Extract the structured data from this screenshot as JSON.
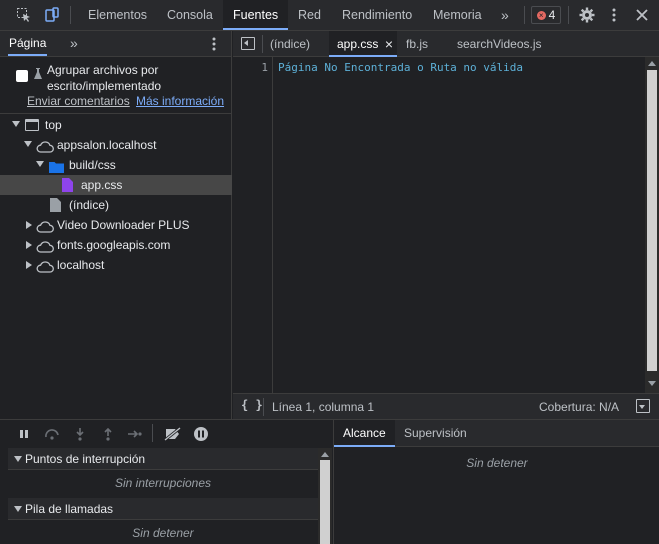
{
  "main_tabs": [
    "Elementos",
    "Consola",
    "Fuentes",
    "Red",
    "Rendimiento",
    "Memoria"
  ],
  "more_tabs": "»",
  "error_count": "4",
  "left": {
    "tab_label": "Página",
    "more": "»",
    "group_checkbox_label": "Agrupar archivos por escrito/implementado",
    "feedback_link": "Enviar comentarios",
    "more_info_link": "Más información",
    "tree": [
      {
        "label": "top",
        "icon": "frame-icon"
      },
      {
        "label": "appsalon.localhost",
        "icon": "cloud-icon"
      },
      {
        "label": "build/css",
        "icon": "folder-icon"
      },
      {
        "label": "app.css",
        "icon": "file-icon"
      },
      {
        "label": "(índice)",
        "icon": "file-icon"
      },
      {
        "label": "Video Downloader PLUS",
        "icon": "cloud-icon"
      },
      {
        "label": "fonts.googleapis.com",
        "icon": "cloud-icon"
      },
      {
        "label": "localhost",
        "icon": "cloud-icon"
      }
    ]
  },
  "editor": {
    "tabs": [
      "(índice)",
      "app.css",
      "fb.js",
      "searchVideos.js"
    ],
    "close_glyph": "×",
    "line_number": "1",
    "code_line": "Página No Encontrada o Ruta no válida",
    "status_left_icon": "{ }",
    "status_position": "Línea 1, columna 1",
    "status_coverage": "Cobertura: N/A"
  },
  "debugger": {
    "breakpoints_title": "Puntos de interrupción",
    "breakpoints_empty": "Sin interrupciones",
    "callstack_title": "Pila de llamadas",
    "callstack_empty": "Sin detener"
  },
  "scope": {
    "tabs": [
      "Alcance",
      "Supervisión"
    ],
    "empty": "Sin detener"
  },
  "colors": {
    "accent": "#7cacf8",
    "folder": "#1a73e8",
    "css_file": "#8e44ec",
    "code_text": "#5db0d7",
    "error_badge": "#e46962"
  }
}
